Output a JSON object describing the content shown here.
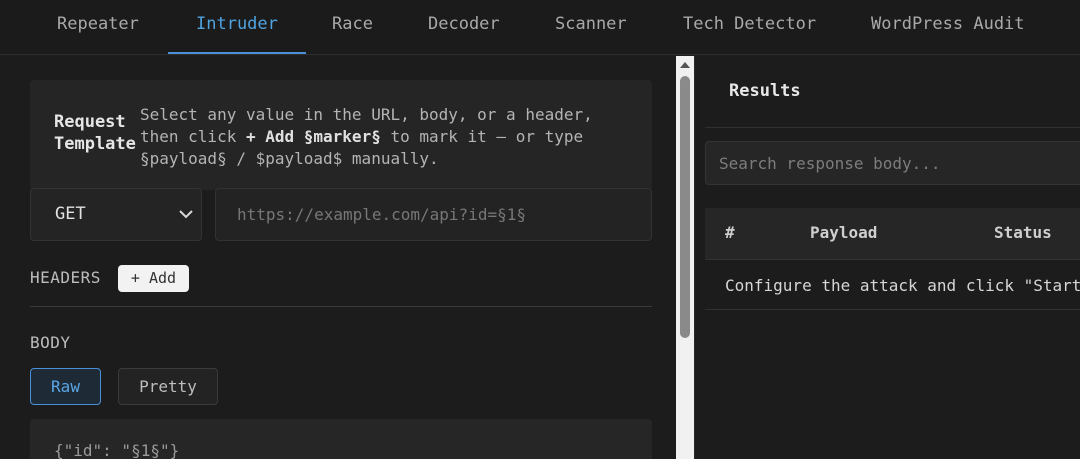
{
  "tabs": [
    {
      "label": "Repeater"
    },
    {
      "label": "Intruder"
    },
    {
      "label": "Race"
    },
    {
      "label": "Decoder"
    },
    {
      "label": "Scanner"
    },
    {
      "label": "Tech Detector"
    },
    {
      "label": "WordPress Audit"
    }
  ],
  "active_tab": "Intruder",
  "request_template": {
    "label_line1": "Request",
    "label_line2": "Template",
    "help_line1": "Select any value in the URL, body, or a header,",
    "help_line2_pre": "then click ",
    "help_add": "+ Add §marker§",
    "help_line2_post": " to mark it — or type",
    "help_line3": "§payload§ / $payload$ manually."
  },
  "method": {
    "value": "GET"
  },
  "url": {
    "placeholder": "https://example.com/api?id=§1§"
  },
  "headers": {
    "label": "HEADERS",
    "add_label": "+ Add"
  },
  "body": {
    "label": "BODY",
    "raw_label": "Raw",
    "pretty_label": "Pretty",
    "active_mode": "Raw",
    "content": "{\"id\": \"§1§\"}"
  },
  "results": {
    "title": "Results",
    "search_placeholder": "Search response body...",
    "columns": [
      "#",
      "Payload",
      "Status"
    ],
    "empty_message": "Configure the attack and click \"Start"
  },
  "colors": {
    "accent": "#4a90d9",
    "background": "#1c1c1c"
  }
}
